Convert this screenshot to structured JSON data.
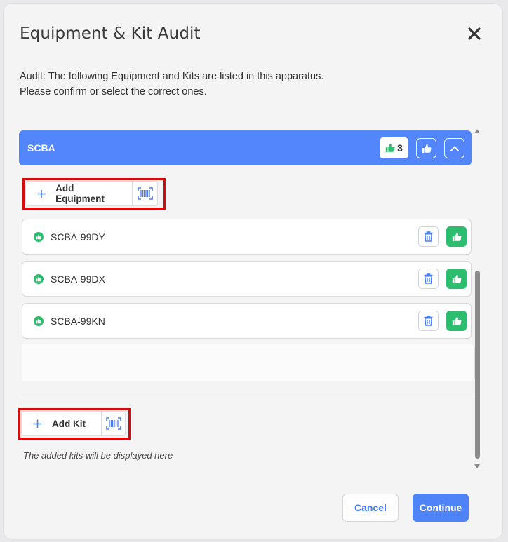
{
  "modal": {
    "title": "Equipment & Kit Audit",
    "intro_line1": "Audit: The following Equipment and Kits are listed in this apparatus.",
    "intro_line2": "Please confirm or select the correct ones."
  },
  "group": {
    "title": "SCBA",
    "approved_count": "3",
    "add_equipment_label": "Add Equipment",
    "items": [
      {
        "name": "SCBA-99DY",
        "status": "approved"
      },
      {
        "name": "SCBA-99DX",
        "status": "approved"
      },
      {
        "name": "SCBA-99KN",
        "status": "approved"
      }
    ]
  },
  "kits": {
    "add_kit_label": "Add Kit",
    "empty_note": "The added kits will be displayed here"
  },
  "footer": {
    "cancel_label": "Cancel",
    "continue_label": "Continue"
  },
  "colors": {
    "primary": "#5486fb",
    "success": "#2dbd6e",
    "highlight": "#d40c0c"
  },
  "icons": [
    "close-icon",
    "thumbs-up-icon",
    "chevron-up-icon",
    "plus-icon",
    "barcode-icon",
    "trash-icon"
  ]
}
